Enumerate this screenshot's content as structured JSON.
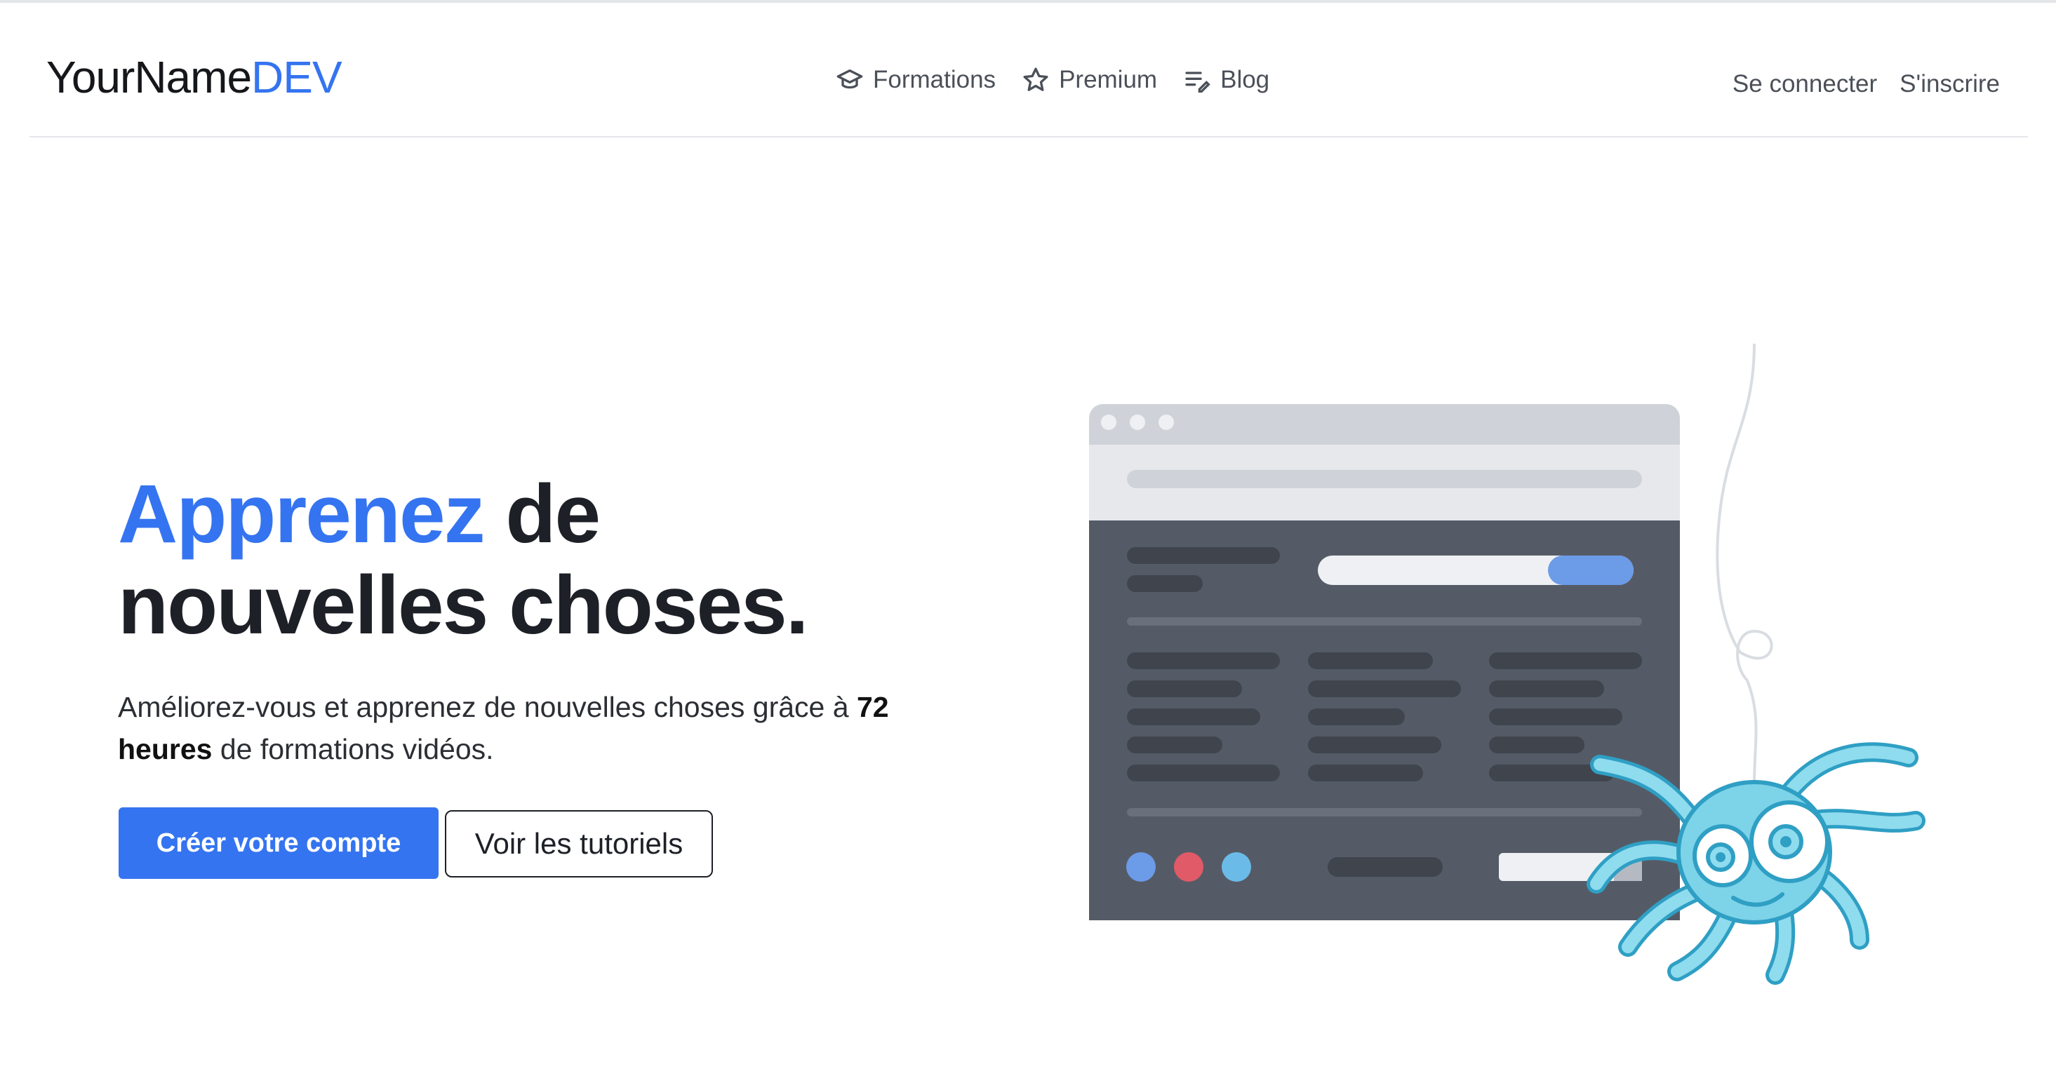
{
  "header": {
    "logo_part1": "YourName",
    "logo_part2": "DEV",
    "nav": [
      {
        "label": "Formations",
        "icon": "graduation-cap-icon"
      },
      {
        "label": "Premium",
        "icon": "star-icon"
      },
      {
        "label": "Blog",
        "icon": "edit-list-icon"
      }
    ],
    "login_label": "Se connecter",
    "signup_label": "S'inscrire"
  },
  "hero": {
    "title_highlight": "Apprenez",
    "title_line1_rest": " de",
    "title_line2": "nouvelles choses.",
    "subtitle_before": "Améliorez-vous et apprenez de nouvelles choses grâce à ",
    "subtitle_bold": "72 heures",
    "subtitle_after": " de formations vidéos.",
    "cta_primary": "Créer votre compte",
    "cta_secondary": "Voir les tutoriels"
  },
  "colors": {
    "accent": "#3574f0",
    "text_dark": "#1d2026",
    "illustration_window": "#555b66",
    "spider": "#7dd3e8"
  }
}
